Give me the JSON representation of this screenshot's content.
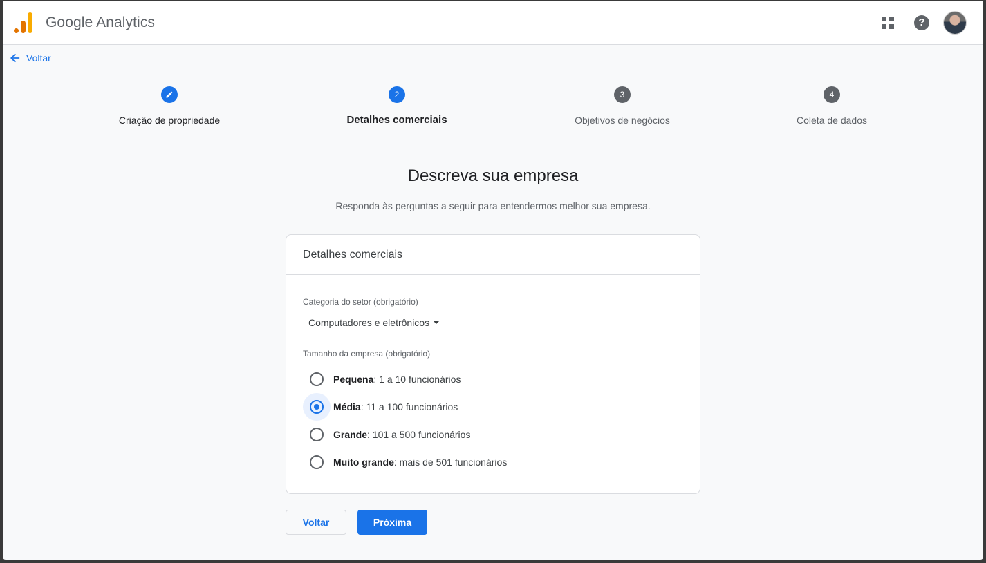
{
  "header": {
    "app_title": "Google Analytics",
    "apps_icon": "apps-grid-icon",
    "help_icon": "help-icon",
    "help_glyph": "?",
    "avatar": "user-avatar",
    "logo_colors": [
      "#f9ab00",
      "#e37400"
    ]
  },
  "nav": {
    "back_label": "Voltar"
  },
  "stepper": {
    "steps": [
      {
        "number": "",
        "label": "Criação de propriedade",
        "state": "completed"
      },
      {
        "number": "2",
        "label": "Detalhes comerciais",
        "state": "active"
      },
      {
        "number": "3",
        "label": "Objetivos de negócios",
        "state": "pending"
      },
      {
        "number": "4",
        "label": "Coleta de dados",
        "state": "pending"
      }
    ],
    "active_color": "#1a73e8",
    "pending_color": "#5f6368"
  },
  "main": {
    "heading": "Descreva sua empresa",
    "subheading": "Responda às perguntas a seguir para entendermos melhor sua empresa."
  },
  "card": {
    "title": "Detalhes comerciais",
    "industry_label": "Categoria do setor (obrigatório)",
    "industry_value": "Computadores e eletrônicos",
    "size_label": "Tamanho da empresa (obrigatório)",
    "size_options": [
      {
        "name": "Pequena",
        "desc": ": 1 a 10 funcionários",
        "checked": false
      },
      {
        "name": "Média",
        "desc": ": 11 a 100 funcionários",
        "checked": true
      },
      {
        "name": "Grande",
        "desc": ": 101 a 500 funcionários",
        "checked": false
      },
      {
        "name": "Muito grande",
        "desc": ": mais de 501 funcionários",
        "checked": false
      }
    ]
  },
  "actions": {
    "back_label": "Voltar",
    "next_label": "Próxima"
  }
}
